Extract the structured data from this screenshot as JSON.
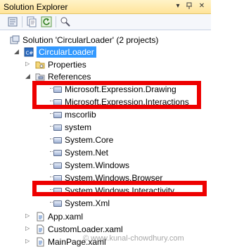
{
  "window": {
    "title": "Solution Explorer",
    "pin_glyph": "▾ ⊓ ×"
  },
  "toolbar": {
    "icons": [
      "properties-icon",
      "show-all-files-icon",
      "refresh-icon",
      "view-class-diagram-icon"
    ]
  },
  "tree": {
    "solution": "Solution 'CircularLoader' (2 projects)",
    "project": "CircularLoader",
    "properties": "Properties",
    "references": "References",
    "refs": [
      "Microsoft.Expression.Drawing",
      "Microsoft.Expression.Interactions",
      "mscorlib",
      "system",
      "System.Core",
      "System.Net",
      "System.Windows",
      "System.Windows.Browser",
      "System.Windows.Interactivity",
      "System.Xml"
    ],
    "files": [
      "App.xaml",
      "CustomLoader.xaml",
      "MainPage.xaml"
    ]
  },
  "watermark": "© www.kunal-chowdhury.com",
  "colors": {
    "highlight": "#ee0000",
    "selection": "#3399ff",
    "titlebar": "#ffe49a"
  }
}
